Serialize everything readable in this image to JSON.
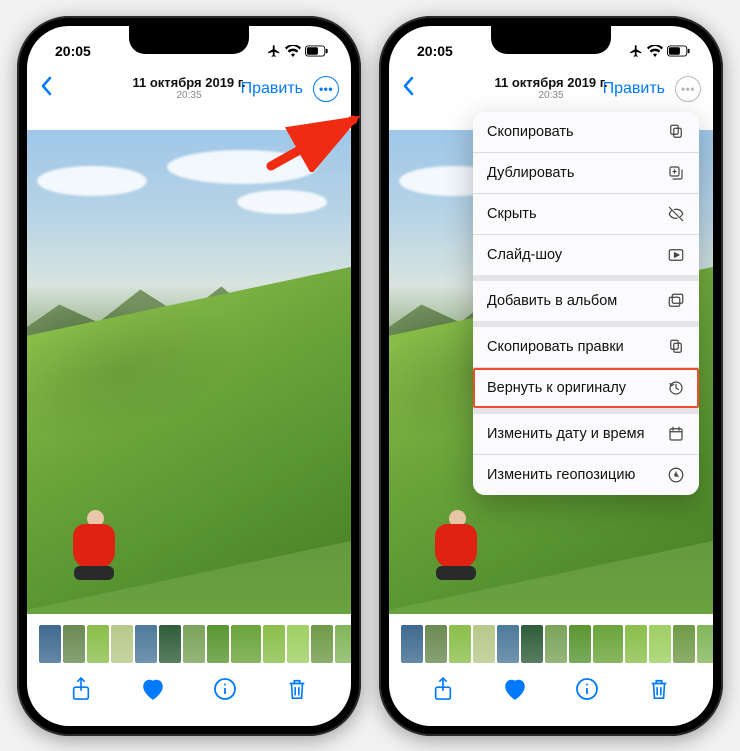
{
  "status": {
    "time": "20:05"
  },
  "nav": {
    "date": "11 октября 2019 г.",
    "time": "20:35",
    "edit": "Править"
  },
  "toolbar_icons": [
    "share",
    "heart",
    "info",
    "trash"
  ],
  "menu": {
    "items": [
      {
        "label": "Скопировать",
        "icon": "copy"
      },
      {
        "label": "Дублировать",
        "icon": "duplicate"
      },
      {
        "label": "Скрыть",
        "icon": "hide"
      },
      {
        "label": "Слайд-шоу",
        "icon": "play"
      },
      {
        "label": "Добавить в альбом",
        "icon": "album",
        "gap_before": true
      },
      {
        "label": "Скопировать правки",
        "icon": "copy-edits",
        "gap_before": true
      },
      {
        "label": "Вернуть к оригиналу",
        "icon": "revert",
        "highlight": true
      },
      {
        "label": "Изменить дату и время",
        "icon": "calendar",
        "gap_before": true
      },
      {
        "label": "Изменить геопозицию",
        "icon": "location"
      }
    ]
  },
  "thumbs": [
    "#3e6a8f",
    "#6a8a52",
    "#8abf4a",
    "#b7c98a",
    "#4d7a9a",
    "#2f5d3a",
    "#7aa45a",
    "#5a9632",
    "#6aa43a",
    "#8abf4a",
    "#9ecf63",
    "#6f9b47",
    "#83b65a",
    "#b0d27f",
    "#c9dca8"
  ]
}
